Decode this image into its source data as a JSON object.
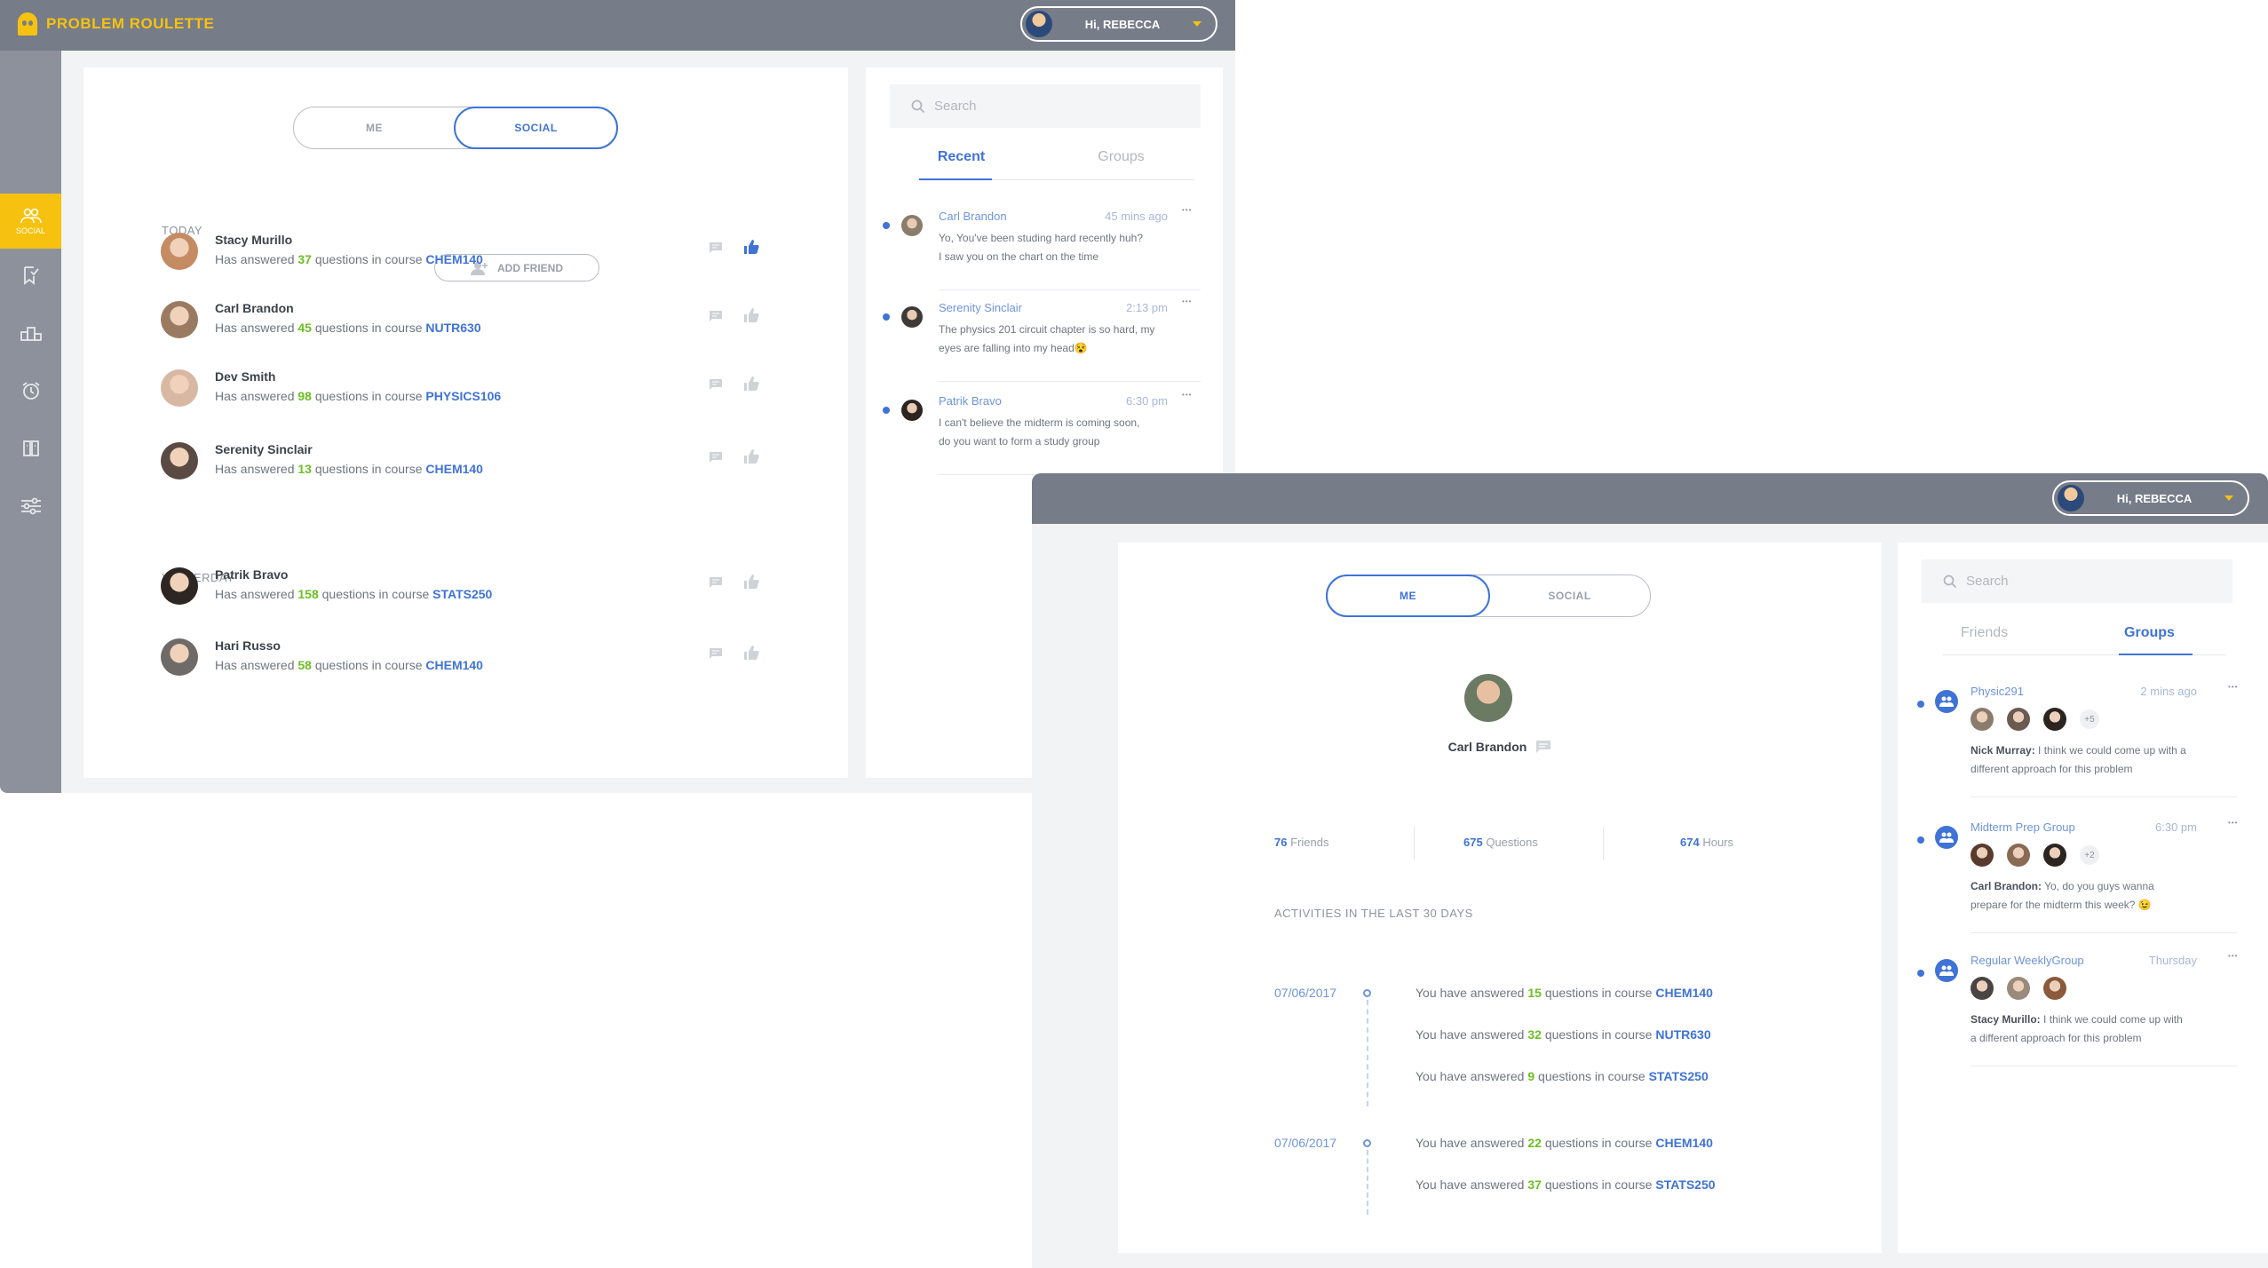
{
  "app": {
    "name": "PROBLEM ROULETTE",
    "greeting": "Hi, REBECCA"
  },
  "colors": {
    "topbar": "#767c88",
    "sidebar": "#8c919c",
    "accent_yellow": "#f6c20f",
    "accent_blue": "#3f73d6",
    "number_green": "#6cc024"
  },
  "sidebar": {
    "items": [
      {
        "icon": "social-icon",
        "label": "SOCIAL",
        "active": true
      },
      {
        "icon": "bookmark-check-icon"
      },
      {
        "icon": "ranking-icon"
      },
      {
        "icon": "alarm-clock-icon"
      },
      {
        "icon": "book-icon"
      },
      {
        "icon": "sliders-icon"
      }
    ]
  },
  "screen1": {
    "toggle": {
      "me": "ME",
      "social": "SOCIAL",
      "active": "social"
    },
    "add_friend": "ADD FRIEND",
    "sections": {
      "today": "TODAY",
      "yesterday": "YESTERDAY"
    },
    "feed": [
      {
        "name": "Stacy Murillo",
        "prefix": "Has answered",
        "count": "37",
        "middle": "questions in course",
        "course": "CHEM140",
        "liked": true
      },
      {
        "name": "Carl Brandon",
        "prefix": "Has answered",
        "count": "45",
        "middle": "questions in course",
        "course": "NUTR630",
        "liked": false
      },
      {
        "name": "Dev Smith",
        "prefix": "Has answered",
        "count": "98",
        "middle": "questions in course",
        "course": "PHYSICS106",
        "liked": false
      },
      {
        "name": "Serenity Sinclair",
        "prefix": "Has answered",
        "count": "13",
        "middle": "questions in course",
        "course": "CHEM140",
        "liked": false
      },
      {
        "name": "Patrik Bravo",
        "prefix": "Has answered",
        "count": "158",
        "middle": "questions in course",
        "course": "STATS250",
        "liked": false
      },
      {
        "name": "Hari Russo",
        "prefix": "Has answered",
        "count": "58",
        "middle": "questions in course",
        "course": "CHEM140",
        "liked": false
      }
    ],
    "chat": {
      "search_placeholder": "Search",
      "tabs": {
        "recent": "Recent",
        "groups": "Groups",
        "active": "recent"
      },
      "messages": [
        {
          "from": "Carl Brandon",
          "time": "45 mins ago",
          "line1": "Yo, You've been studing hard recently huh?",
          "line2": "I saw you on the chart on the time"
        },
        {
          "from": "Serenity Sinclair",
          "time": "2:13 pm",
          "line1": "The physics 201 circuit chapter is so hard, my",
          "line2": "eyes are falling into my head😵"
        },
        {
          "from": "Patrik Bravo",
          "time": "6:30 pm",
          "line1": "I can't believe the midterm is coming soon,",
          "line2": "do you want to form a study group"
        }
      ]
    }
  },
  "screen2": {
    "toggle": {
      "me": "ME",
      "social": "SOCIAL",
      "active": "me"
    },
    "profile": {
      "name": "Carl Brandon"
    },
    "stats": [
      {
        "value": "76",
        "label": "Friends"
      },
      {
        "value": "675",
        "label": "Questions"
      },
      {
        "value": "674",
        "label": "Hours"
      }
    ],
    "activities_title": "ACTIVITIES IN THE LAST 30 DAYS",
    "activity_groups": [
      {
        "date": "07/06/2017",
        "items": [
          {
            "prefix": "You have answered",
            "count": "15",
            "middle": "questions in course",
            "course": "CHEM140"
          },
          {
            "prefix": "You have answered",
            "count": "32",
            "middle": "questions in course",
            "course": "NUTR630"
          },
          {
            "prefix": "You have answered",
            "count": "9",
            "middle": "questions in course",
            "course": "STATS250"
          }
        ]
      },
      {
        "date": "07/06/2017",
        "items": [
          {
            "prefix": "You have answered",
            "count": "22",
            "middle": "questions in course",
            "course": "CHEM140"
          },
          {
            "prefix": "You have answered",
            "count": "37",
            "middle": "questions in course",
            "course": "STATS250"
          }
        ]
      }
    ],
    "chat": {
      "search_placeholder": "Search",
      "tabs": {
        "friends": "Friends",
        "groups": "Groups",
        "active": "groups"
      },
      "groups": [
        {
          "name": "Physic291",
          "time": "2 mins ago",
          "extra": "+5",
          "author": "Nick Murray:",
          "line1": "I think we could come up with a",
          "line2": "different approach for this problem"
        },
        {
          "name": "Midterm Prep Group",
          "time": "6:30 pm",
          "extra": "+2",
          "author": "Carl Brandon:",
          "line1": "Yo, do you guys wanna",
          "line2": "prepare for the midterm this week? 😉"
        },
        {
          "name": "Regular WeeklyGroup",
          "time": "Thursday",
          "extra": "",
          "author": "Stacy Murillo:",
          "line1": "I think we could come up with",
          "line2": "a different approach for this problem"
        }
      ]
    }
  }
}
